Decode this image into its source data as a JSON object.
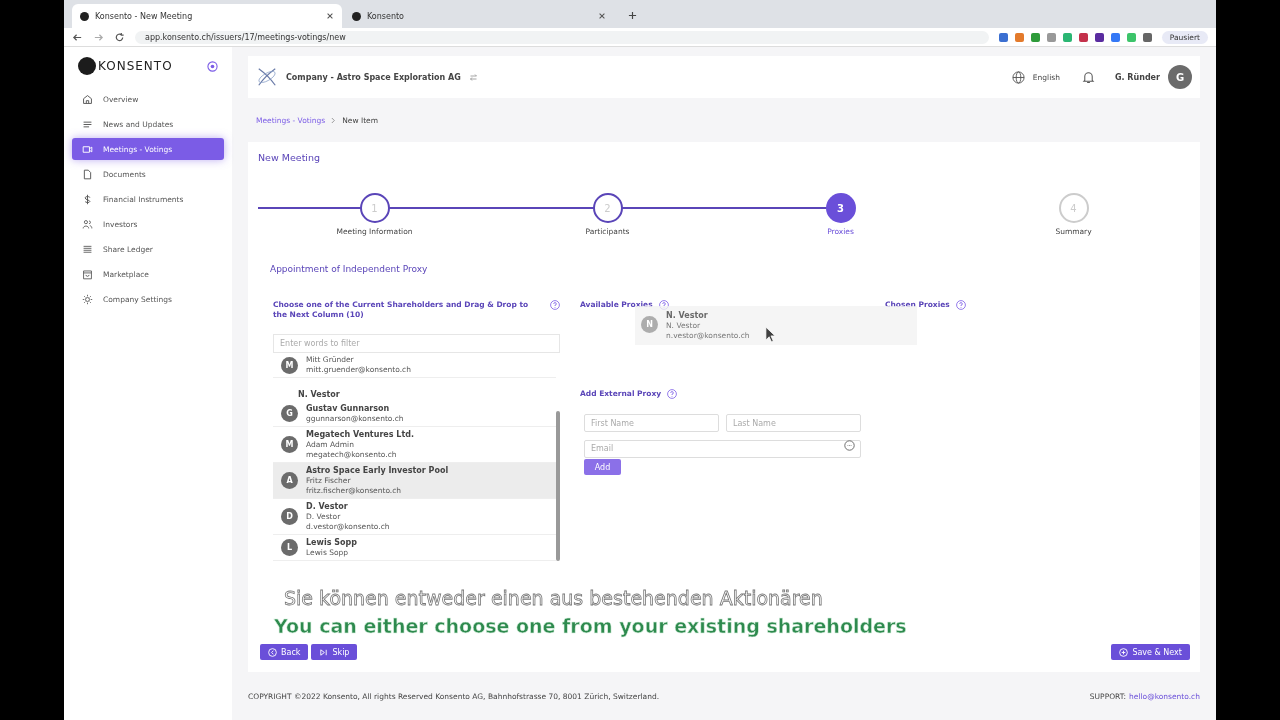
{
  "browser": {
    "tabs": [
      {
        "title": "Konsento - New Meeting",
        "selected": true
      },
      {
        "title": "Konsento",
        "selected": false
      }
    ],
    "url": "app.konsento.ch/issuers/17/meetings-votings/new",
    "profile": "Pausiert"
  },
  "sidebar": {
    "logo": "KONSENTO",
    "items": [
      {
        "label": "Overview",
        "kind": "home",
        "selected": false
      },
      {
        "label": "News and Updates",
        "kind": "lines",
        "selected": false
      },
      {
        "label": "Meetings - Votings",
        "kind": "video",
        "selected": true
      },
      {
        "label": "Documents",
        "kind": "file",
        "selected": false
      },
      {
        "label": "Financial Instruments",
        "kind": "dollar",
        "selected": false
      },
      {
        "label": "Investors",
        "kind": "people",
        "selected": false
      },
      {
        "label": "Share Ledger",
        "kind": "ledger",
        "selected": false
      },
      {
        "label": "Marketplace",
        "kind": "bag",
        "selected": false
      },
      {
        "label": "Company Settings",
        "kind": "gear",
        "selected": false
      }
    ]
  },
  "header": {
    "company": "Company - Astro Space Exploration AG",
    "language": "English",
    "user": "G. Ründer",
    "avatar": "G"
  },
  "breadcrumb": [
    "Meetings - Votings",
    "New Item"
  ],
  "page_title": "New Meeting",
  "steps": [
    {
      "number": "1",
      "label": "Meeting Information",
      "completed": true,
      "selected": false
    },
    {
      "number": "2",
      "label": "Participants",
      "completed": true,
      "selected": false
    },
    {
      "number": "3",
      "label": "Proxies",
      "completed": false,
      "selected": true
    },
    {
      "number": "4",
      "label": "Summary",
      "completed": false,
      "selected": false
    }
  ],
  "section_title": "Appointment of Independent Proxy",
  "shareholders": {
    "title": "Choose one of the Current Shareholders and Drag & Drop to the Next Column (10)",
    "filter_placeholder": "Enter words to filter",
    "rows": [
      {
        "kind": "row",
        "initial": "M",
        "name": "",
        "contact": "Mitt Gründer",
        "email": "mitt.gruender@konsento.ch",
        "highlighted": false
      },
      {
        "kind": "ghost",
        "name": "N. Vestor"
      },
      {
        "kind": "row",
        "initial": "G",
        "name": "Gustav Gunnarson",
        "contact": "",
        "email": "ggunnarson@konsento.ch",
        "highlighted": false
      },
      {
        "kind": "row",
        "initial": "M",
        "name": "Megatech Ventures Ltd.",
        "contact": "Adam Admin",
        "email": "megatech@konsento.ch",
        "highlighted": false
      },
      {
        "kind": "row",
        "initial": "A",
        "name": "Astro Space Early Investor Pool",
        "contact": "Fritz Fischer",
        "email": "fritz.fischer@konsento.ch",
        "highlighted": true
      },
      {
        "kind": "row",
        "initial": "D",
        "name": "D. Vestor",
        "contact": "D. Vestor",
        "email": "d.vestor@konsento.ch",
        "highlighted": false
      },
      {
        "kind": "row",
        "initial": "L",
        "name": "Lewis Sopp",
        "contact": "Lewis Sopp",
        "email": "",
        "highlighted": false
      }
    ]
  },
  "available_proxies": {
    "title": "Available Proxies",
    "dragged": {
      "initial": "N",
      "name": "N. Vestor",
      "contact": "N. Vestor",
      "email": "n.vestor@konsento.ch"
    }
  },
  "chosen_proxies": {
    "title": "Chosen Proxies"
  },
  "external_proxy": {
    "title": "Add External Proxy",
    "first_name": {
      "placeholder": "First Name"
    },
    "last_name": {
      "placeholder": "Last Name"
    },
    "email": {
      "placeholder": "Email"
    },
    "button": "Add"
  },
  "actions": {
    "back": "Back",
    "skip": "Skip",
    "save": "Save & Next"
  },
  "subtitles": [
    "Sie können entweder einen aus bestehenden Aktionären",
    "You can either choose one from your existing shareholders"
  ],
  "footer": {
    "copyright": "COPYRIGHT ©2022 Konsento, All rights Reserved Konsento AG, Bahnhofstrasse 70, 8001 Zürich, Switzerland.",
    "support_label": "SUPPORT:",
    "support_email": "hello@konsento.ch"
  }
}
